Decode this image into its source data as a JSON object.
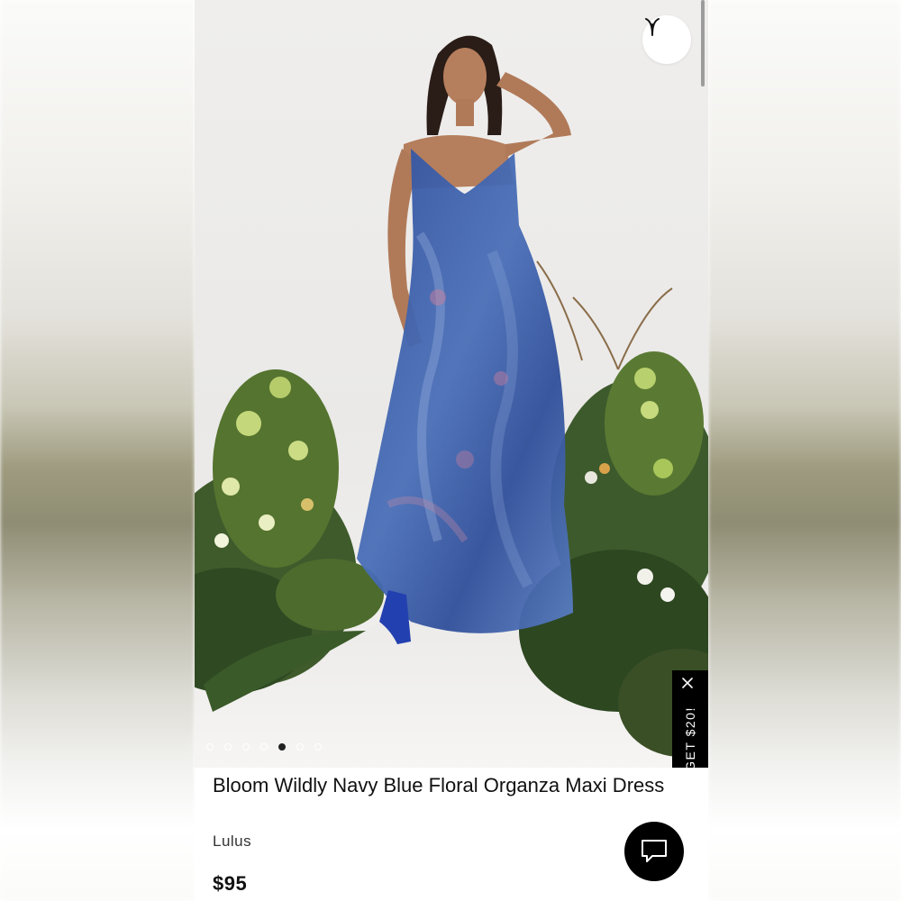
{
  "product": {
    "title": "Bloom Wildly Navy Blue Floral Organza Maxi Dress",
    "brand": "Lulus",
    "price": "$95"
  },
  "gallery": {
    "image_count": 7,
    "active_index": 4
  },
  "promo": {
    "label": "GET $20!"
  },
  "icons": {
    "favorite": "heart-icon",
    "close": "close-icon",
    "chat": "chat-bubble-icon"
  },
  "colors": {
    "dress_blue": "#3a5aa6",
    "promo_bg": "#000000",
    "chat_bg": "#000000"
  }
}
